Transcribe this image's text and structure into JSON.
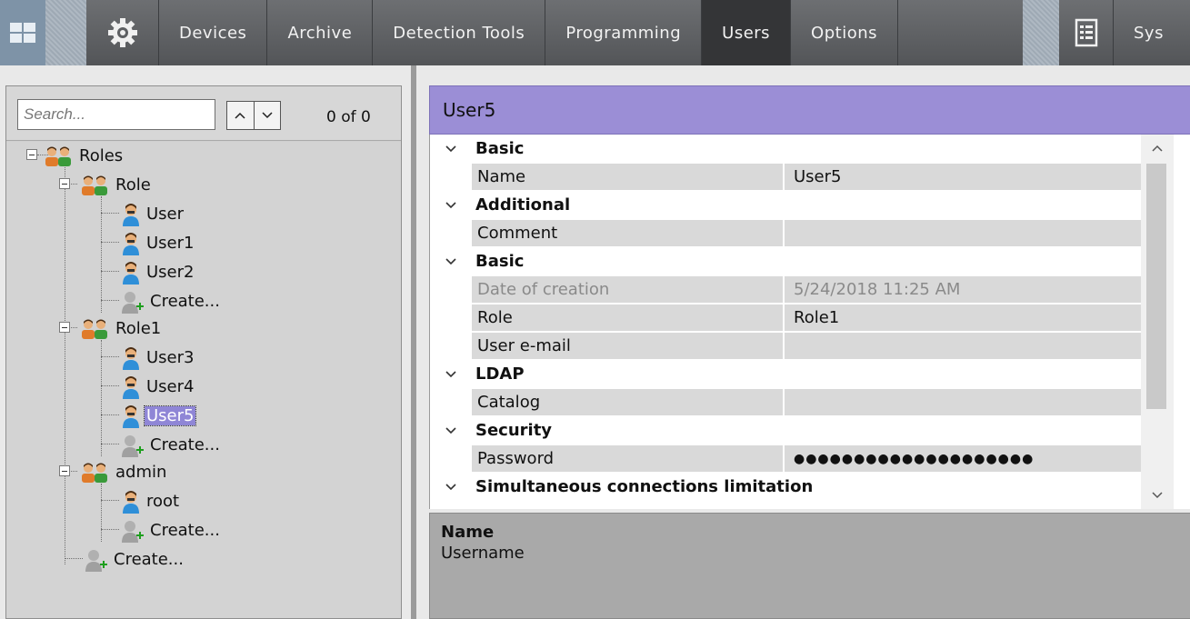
{
  "toolbar": {
    "tabs": [
      {
        "label": "Devices"
      },
      {
        "label": "Archive"
      },
      {
        "label": "Detection Tools"
      },
      {
        "label": "Programming"
      },
      {
        "label": "Users"
      },
      {
        "label": "Options"
      }
    ],
    "active_tab": "Users",
    "truncated_tab": "Sys",
    "icons": [
      "grid-icon",
      "gear-icon",
      "document-icon"
    ]
  },
  "search": {
    "placeholder": "Search...",
    "value": "",
    "count": "0 of 0"
  },
  "tree": {
    "roles_label": "Roles",
    "role_label": "Role",
    "role_users": [
      "User",
      "User1",
      "User2"
    ],
    "role1_label": "Role1",
    "role1_users": [
      "User3",
      "User4",
      "User5"
    ],
    "admin_label": "admin",
    "admin_users": [
      "root"
    ],
    "create_label": "Create...",
    "selected": "User5"
  },
  "properties": {
    "title": "User5",
    "categories": {
      "basic1": "Basic",
      "additional": "Additional",
      "basic2": "Basic",
      "ldap": "LDAP",
      "security": "Security",
      "simultaneous": "Simultaneous connections limitation"
    },
    "rows": {
      "name": {
        "name": "Name",
        "value": "User5"
      },
      "comment": {
        "name": "Comment",
        "value": ""
      },
      "date": {
        "name": "Date of creation",
        "value": "5/24/2018 11:25 AM"
      },
      "role": {
        "name": "Role",
        "value": "Role1"
      },
      "email": {
        "name": "User e-mail",
        "value": ""
      },
      "catalog": {
        "name": "Catalog",
        "value": ""
      },
      "password": {
        "name": "Password",
        "value": "●●●●●●●●●●●●●●●●●●●●"
      }
    }
  },
  "description": {
    "title": "Name",
    "text": "Username"
  },
  "colors": {
    "header_bar": "#9b8ed6",
    "selected_item": "#8f86d6",
    "active_tab": "#343537"
  }
}
